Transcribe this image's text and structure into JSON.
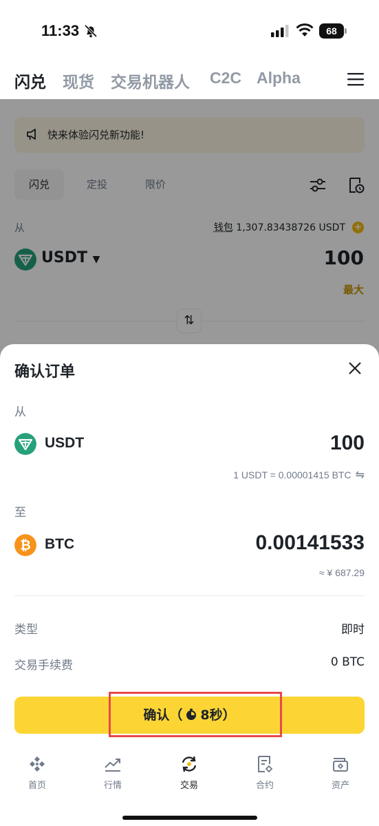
{
  "status_bar": {
    "time": "11:33",
    "battery": "68"
  },
  "top_nav": {
    "tabs": [
      {
        "label": "闪兑",
        "active": true
      },
      {
        "label": "现货",
        "active": false
      },
      {
        "label": "交易机器人",
        "active": false
      },
      {
        "label": "C2C",
        "active": false
      },
      {
        "label": "Alpha",
        "active": false
      }
    ]
  },
  "background": {
    "banner": "快来体验闪兑新功能!",
    "mode_tabs": [
      "闪兑",
      "定投",
      "限价"
    ],
    "from_label": "从",
    "wallet_label": "钱包",
    "wallet_balance": "1,307.83438726 USDT",
    "coin": "USDT",
    "amount": "100",
    "max_label": "最大"
  },
  "sheet": {
    "title": "确认订单",
    "from_label": "从",
    "from_coin": "USDT",
    "from_amount": "100",
    "rate": "1 USDT = 0.00001415 BTC",
    "to_label": "至",
    "to_coin": "BTC",
    "to_amount": "0.00141533",
    "fiat_value": "≈ ¥ 687.29",
    "type_label": "类型",
    "type_value": "即时",
    "fee_label": "交易手续费",
    "fee_value": "0 BTC",
    "confirm_label": "确认（",
    "confirm_timer": "8秒）"
  },
  "bottom_nav": {
    "items": [
      {
        "label": "首页",
        "icon": "home-icon"
      },
      {
        "label": "行情",
        "icon": "markets-icon"
      },
      {
        "label": "交易",
        "icon": "trade-icon",
        "active": true
      },
      {
        "label": "合约",
        "icon": "futures-icon"
      },
      {
        "label": "资产",
        "icon": "wallet-icon"
      }
    ]
  },
  "colors": {
    "accent": "#fcd535",
    "usdt": "#26a17b",
    "btc": "#f7931a",
    "highlight": "#e8484a"
  }
}
